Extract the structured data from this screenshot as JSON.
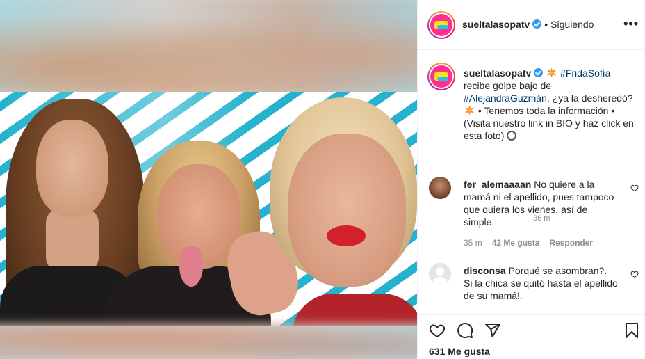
{
  "post": {
    "username": "sueltalasopatv",
    "follow_separator": "•",
    "follow_status": "Siguiendo",
    "more_label": "•••",
    "avatar_text": "SUELTA LA SOPA"
  },
  "caption": {
    "username": "sueltalasopatv",
    "hashtag1": "#FridaSofía",
    "text1": "recibe golpe bajo de",
    "hashtag2": "#AlejandraGuzmán",
    "text2": ", ¿ya la desheredó?",
    "text3": "• Tenemos toda la información • (Visita nuestro link in BIO y haz click en esta foto)",
    "time": "36 m"
  },
  "comments": [
    {
      "username": "fer_alemaaaan",
      "text": "No quiere a la mamá ni el apellido, pues tampoco que quiera los vienes, así de simple.",
      "time": "35 m",
      "likes": "42 Me gusta",
      "reply": "Responder"
    },
    {
      "username": "disconsa",
      "text": "Porqué se asombran?. Si la chica se quitó hasta el apellido de su mamá!."
    }
  ],
  "actions": {
    "likes_count": "631 Me gusta"
  },
  "colors": {
    "text": "#262626",
    "muted": "#8e8e8e",
    "hashtag": "#00376b",
    "verified": "#3897f0",
    "stripe": "#24b2cf"
  },
  "icons": [
    "verified-badge-icon",
    "more-icon",
    "heart-icon",
    "comment-icon",
    "share-icon",
    "bookmark-icon",
    "collision-emoji-icon",
    "paperclip-icon"
  ]
}
